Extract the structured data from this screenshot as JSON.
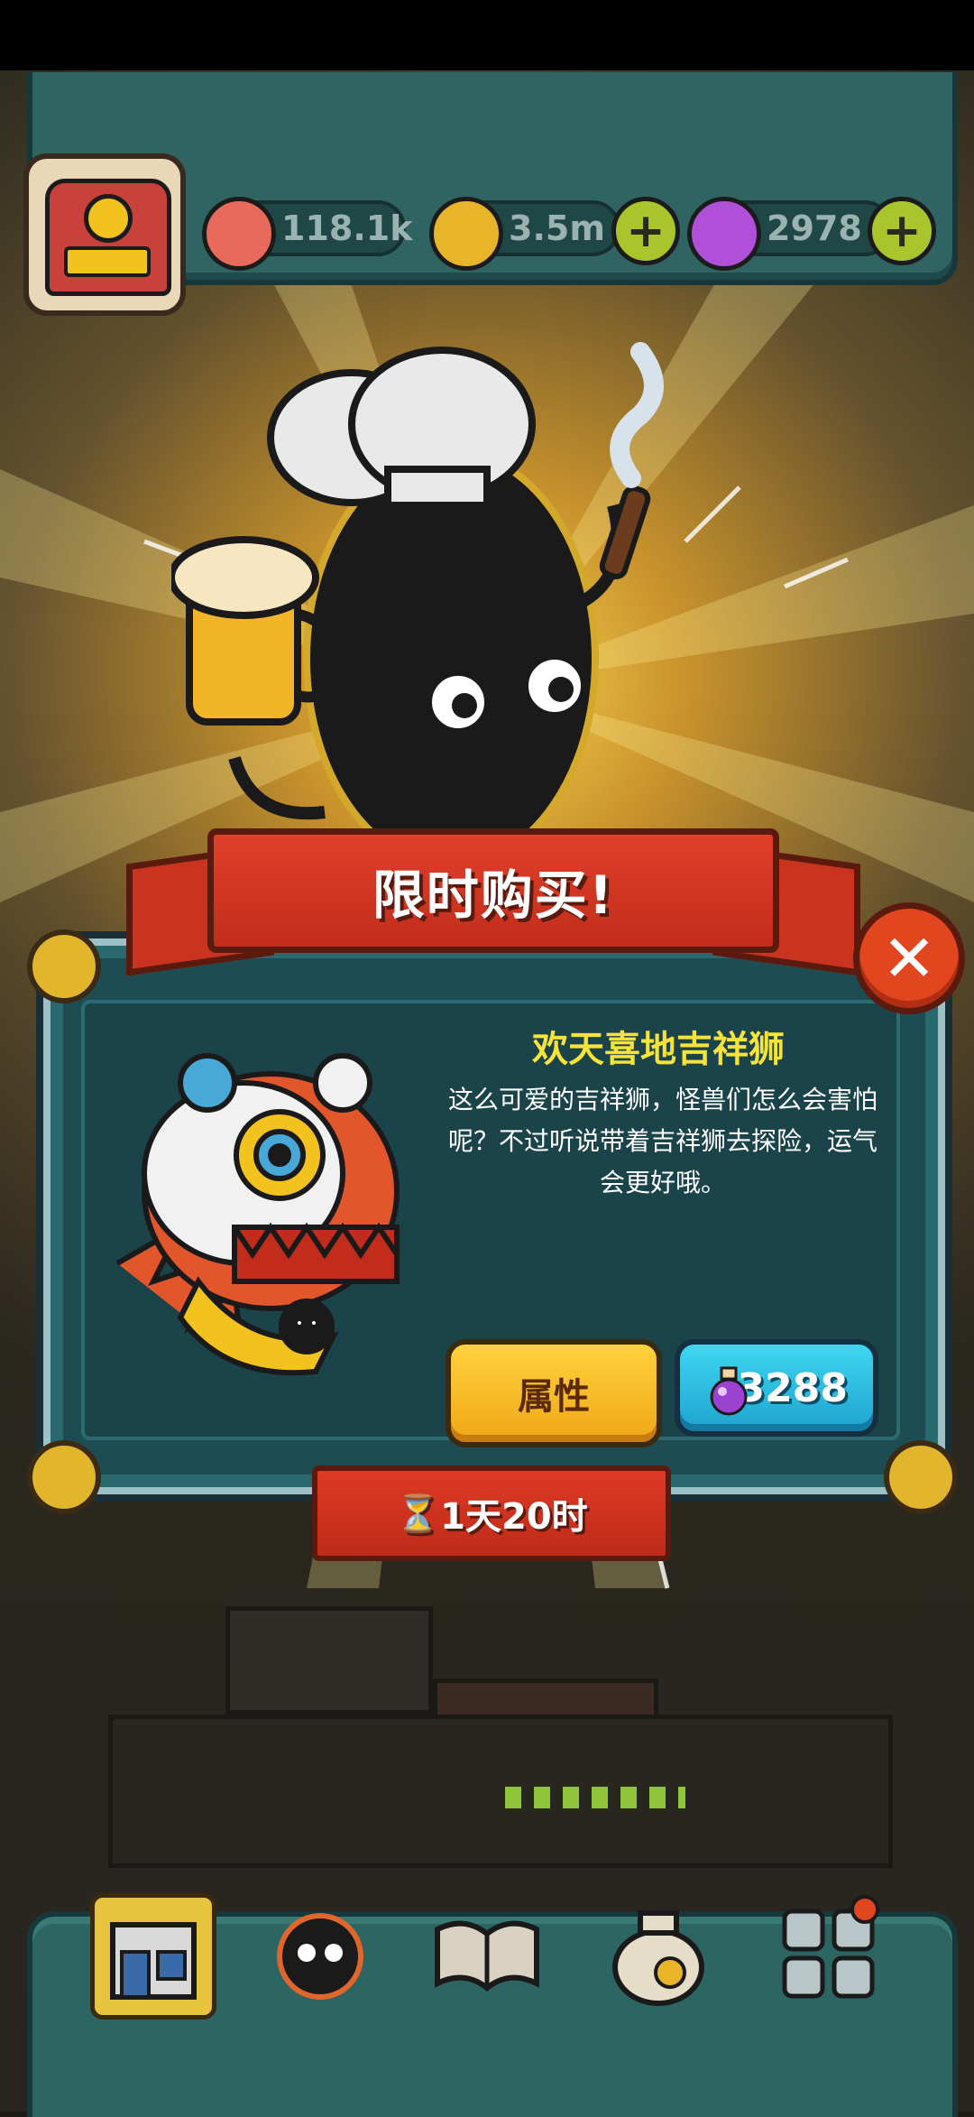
{
  "resources": [
    {
      "icon": "eyeball-icon",
      "value": "118.1k"
    },
    {
      "icon": "gold-coin-icon",
      "value": "3.5m"
    },
    {
      "icon": "potion-icon",
      "value": "2978"
    }
  ],
  "dialog": {
    "banner_title": "限时购买!",
    "item_name": "欢天喜地吉祥狮",
    "item_description": "这么可爱的吉祥狮，怪兽们怎么会害怕呢？不过听说带着吉祥狮去探险，运气会更好哦。",
    "attribute_button": "属性",
    "price": "3288",
    "timer": "1天20时",
    "timer_icon": "⏳"
  },
  "colors": {
    "banner": "#d6361f",
    "title_yellow": "#f6e33a",
    "panel": "#1d4c52",
    "price_button": "#2bbbe0",
    "attr_button": "#f5c12a"
  },
  "bottom_nav": [
    {
      "icon": "restaurant-icon",
      "active": true
    },
    {
      "icon": "monster-icon",
      "active": false
    },
    {
      "icon": "book-icon",
      "active": false
    },
    {
      "icon": "money-bag-icon",
      "active": false
    },
    {
      "icon": "grid-menu-icon",
      "active": false
    }
  ]
}
